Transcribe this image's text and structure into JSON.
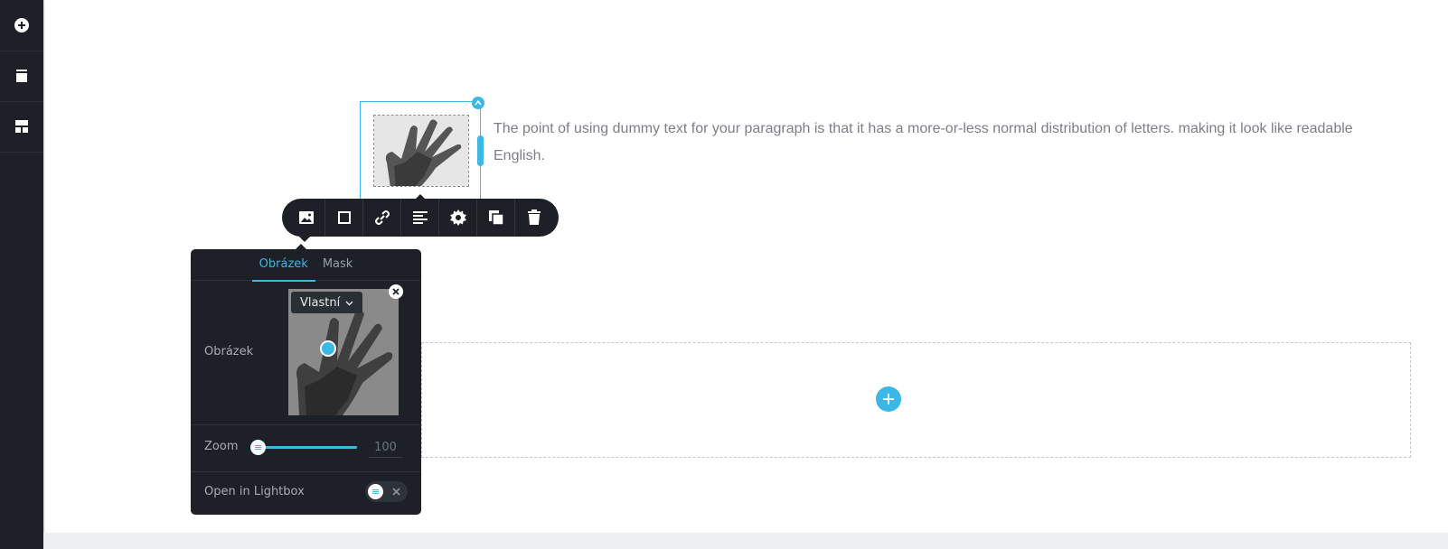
{
  "sidebar": {
    "items": [
      {
        "icon": "plus-circle-icon"
      },
      {
        "icon": "layers-icon"
      },
      {
        "icon": "blocks-icon"
      }
    ]
  },
  "paragraph": {
    "text": "The point of using dummy text for your paragraph is that it has a more-or-less normal distribution of letters. making it look like readable English."
  },
  "toolbar": {
    "items": [
      {
        "icon": "image-icon"
      },
      {
        "icon": "border-icon"
      },
      {
        "icon": "link-icon"
      },
      {
        "icon": "align-left-icon"
      },
      {
        "icon": "gear-icon"
      },
      {
        "icon": "duplicate-icon"
      },
      {
        "icon": "trash-icon"
      }
    ]
  },
  "panel": {
    "tabs": [
      "Obrázek",
      "Mask"
    ],
    "active_tab": "Obrázek",
    "image_label": "Obrázek",
    "size_dropdown": "Vlastní",
    "zoom_label": "Zoom",
    "zoom_value": "100",
    "lightbox_label": "Open in Lightbox",
    "lightbox_enabled": false
  },
  "colors": {
    "accent": "#3bb8e5",
    "dark": "#1d2127",
    "text": "#7a7f86"
  }
}
